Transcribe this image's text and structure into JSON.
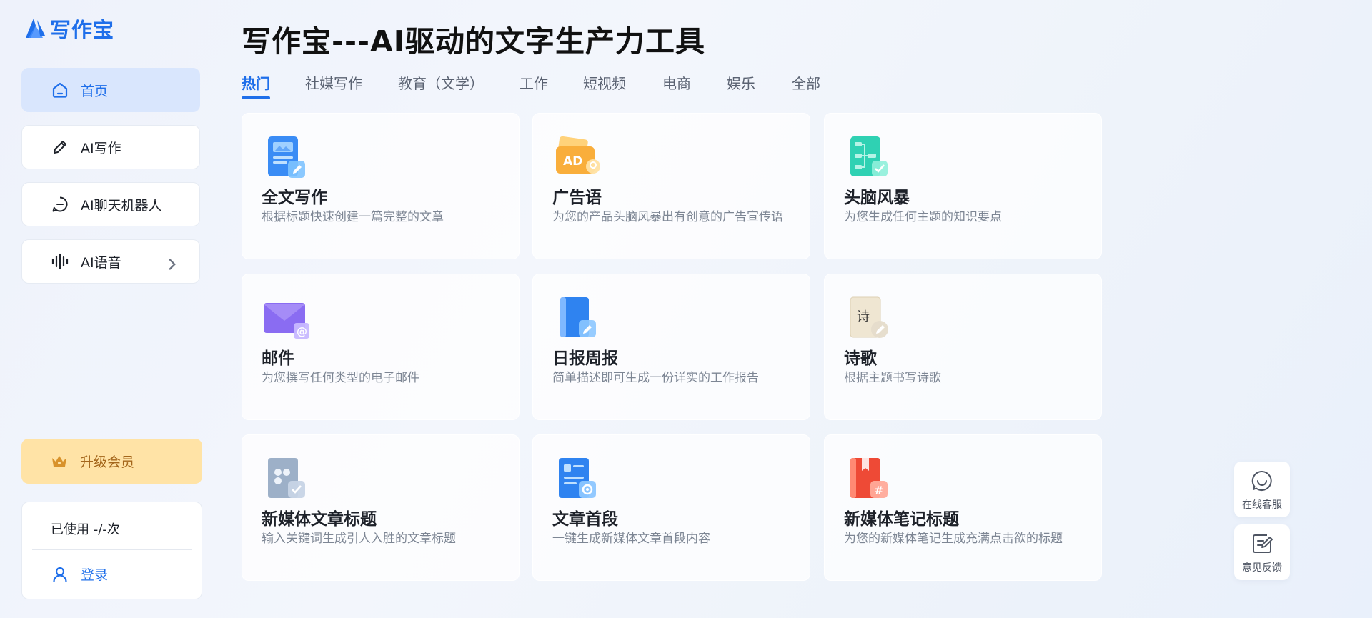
{
  "brand": {
    "name": "写作宝"
  },
  "sidebar": {
    "items": [
      {
        "label": "首页",
        "icon": "home-icon"
      },
      {
        "label": "AI写作",
        "icon": "pencil-icon"
      },
      {
        "label": "AI聊天机器人",
        "icon": "chat-icon"
      },
      {
        "label": "AI语音",
        "icon": "voice-wave-icon"
      }
    ],
    "upgrade_label": "升级会员",
    "usage_text": "已使用 -/-次",
    "login_label": "登录"
  },
  "main": {
    "title": "写作宝---AI驱动的文字生产力工具",
    "tabs": [
      "热门",
      "社媒写作",
      "教育（文学）",
      "工作",
      "短视频",
      "电商",
      "娱乐",
      "全部"
    ],
    "cards": [
      {
        "title": "全文写作",
        "desc": "根据标题快速创建一篇完整的文章",
        "icon": "document-edit-icon"
      },
      {
        "title": "广告语",
        "desc": "为您的产品头脑风暴出有创意的广告宣传语",
        "icon": "ad-icon",
        "icon_text": "AD"
      },
      {
        "title": "头脑风暴",
        "desc": "为您生成任何主题的知识要点",
        "icon": "mindmap-icon"
      },
      {
        "title": "邮件",
        "desc": "为您撰写任何类型的电子邮件",
        "icon": "email-icon"
      },
      {
        "title": "日报周报",
        "desc": "简单描述即可生成一份详实的工作报告",
        "icon": "report-book-icon"
      },
      {
        "title": "诗歌",
        "desc": "根据主题书写诗歌",
        "icon": "poem-icon",
        "icon_text": "诗"
      },
      {
        "title": "新媒体文章标题",
        "desc": "输入关键词生成引人入胜的文章标题",
        "icon": "headline-icon"
      },
      {
        "title": "文章首段",
        "desc": "一键生成新媒体文章首段内容",
        "icon": "paragraph-settings-icon"
      },
      {
        "title": "新媒体笔记标题",
        "desc": "为您的新媒体笔记生成充满点击欲的标题",
        "icon": "note-hashtag-icon"
      }
    ]
  },
  "floating": {
    "service_label": "在线客服",
    "feedback_label": "意见反馈"
  },
  "colors": {
    "accent": "#1f6fea",
    "active_nav_bg": "#d9e6fd",
    "upgrade_bg": "#ffe3a6",
    "upgrade_text": "#a4661b"
  }
}
